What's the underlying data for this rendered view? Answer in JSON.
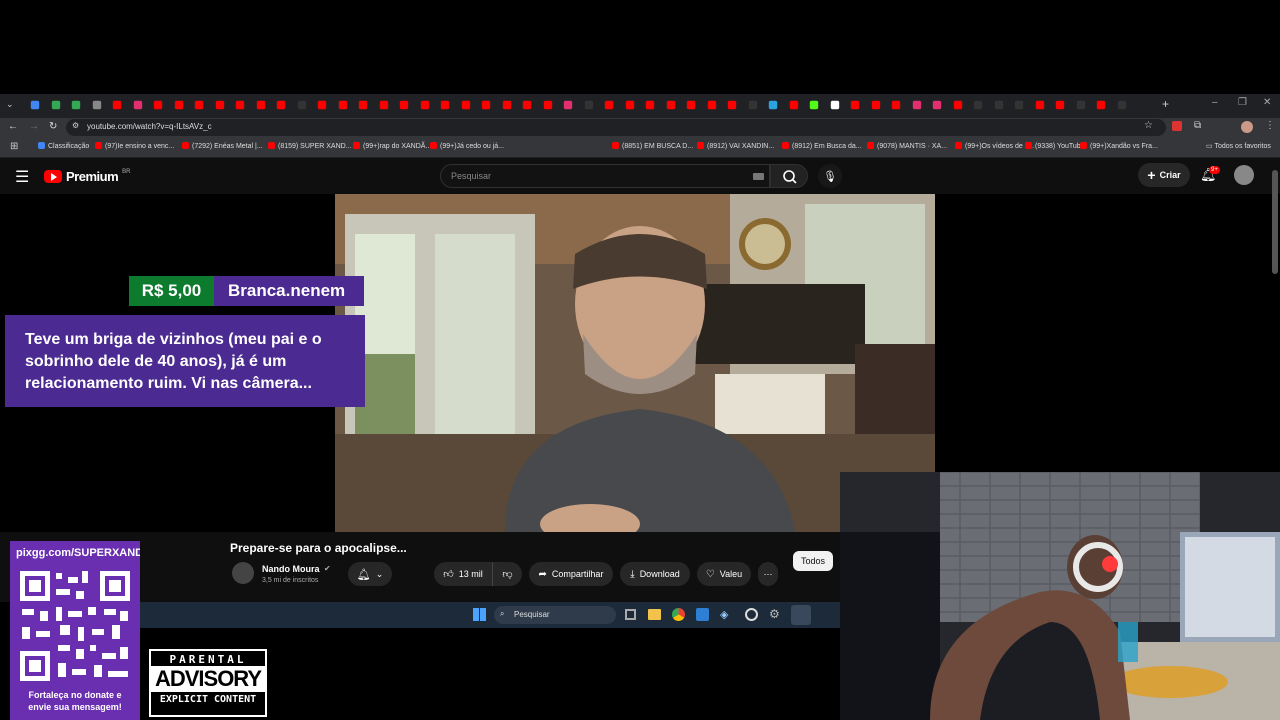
{
  "browser": {
    "url": "youtube.com/watch?v=q-ILtsAVz_c",
    "bookmarks": [
      "Classificação",
      "(97)Ie ensino a venc...",
      "(7292) Enéas Metal |...",
      "(8159) SUPER XAND...",
      "(99+)rap do XANDÃ...",
      "(99+)Já cedo ou já...",
      "(8851) EM BUSCA D...",
      "(8912) VAI XANDIN...",
      "(8912) Em Busca da...",
      "(9078) MANTIS · XA...",
      "(99+)Os vídeos de c...",
      "(9338) YouTube",
      "(99+)Xandão vs Fra..."
    ],
    "all_bookmarks": "Todos os favoritos"
  },
  "youtube": {
    "logo": "Premium",
    "region": "BR",
    "search_placeholder": "Pesquisar",
    "create_label": "Criar",
    "notif_count": "9+"
  },
  "donation": {
    "amount": "R$ 5,00",
    "user": "Branca.nenem",
    "message": "Teve um briga de vizinhos (meu pai e o sobrinho dele de 40 anos), já é um relacionamento ruim. Vi nas câmera..."
  },
  "video": {
    "title": "Prepare-se para o apocalipse...",
    "channel": "Nando Moura",
    "subscribers": "3,5 mi de inscritos",
    "likes": "13 mil",
    "share_label": "Compartilhar",
    "download_label": "Download",
    "thanks_label": "Valeu",
    "filter_chip": "Todos"
  },
  "taskbar": {
    "search_placeholder": "Pesquisar"
  },
  "overlay": {
    "qr_url": "pixgg.com/SUPERXAND",
    "qr_caption": "Fortaleça no donate e envie sua mensagem!",
    "advisory_top": "PARENTAL",
    "advisory_mid": "ADVISORY",
    "advisory_bot": "EXPLICIT CONTENT"
  },
  "colors": {
    "youtube_red": "#ff0000",
    "donation_green": "#0c7b2e",
    "donation_purple": "#4b2a91",
    "qr_purple": "#6a2fb0"
  }
}
